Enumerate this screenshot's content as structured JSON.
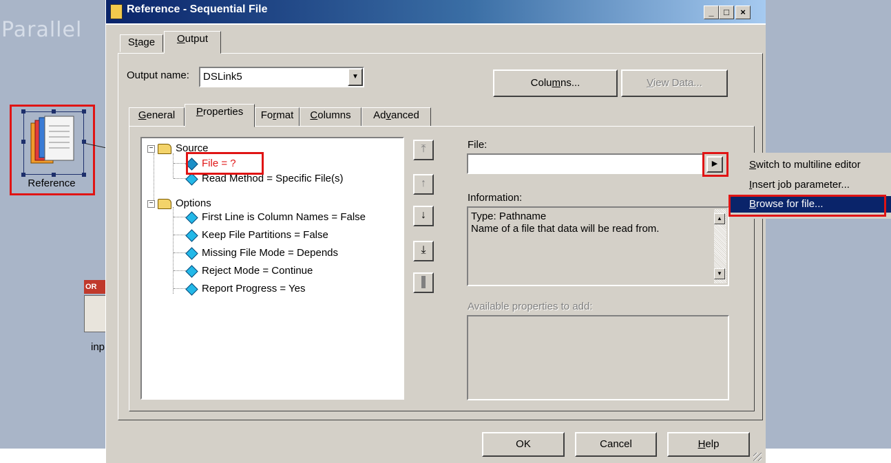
{
  "background": {
    "title": "Parallel",
    "stage_labels": {
      "reference": "Reference",
      "input": "inp",
      "input_badge": "OR"
    }
  },
  "dialog": {
    "title": "Reference - Sequential File",
    "window_buttons": {
      "minimize": "_",
      "maximize": "□",
      "close": "×"
    },
    "top_tabs": [
      {
        "label": "Stage",
        "mnemonic": "t"
      },
      {
        "label": "Output",
        "mnemonic": "O"
      }
    ],
    "output_name": {
      "label": "Output name:",
      "value": "DSLink5"
    },
    "columns_button": "Columns...",
    "view_data_button": "View Data...",
    "inner_tabs": [
      "General",
      "Properties",
      "Format",
      "Columns",
      "Advanced"
    ],
    "tree": {
      "source": "Source",
      "file": "File = ?",
      "read_method": "Read Method = Specific File(s)",
      "options": "Options",
      "option_items": [
        "First Line is Column Names = False",
        "Keep File Partitions = False",
        "Missing File Mode = Depends",
        "Reject Mode = Continue",
        "Report Progress = Yes"
      ]
    },
    "file_label": "File:",
    "file_value": "",
    "information_label": "Information:",
    "information_text": [
      "Type: Pathname",
      "Name of a file that data will be read from."
    ],
    "available_label": "Available properties to add:",
    "ok_button": "OK",
    "cancel_button": "Cancel",
    "help_button": "Help"
  },
  "context_menu": {
    "items": [
      "Switch to multiline editor",
      "Insert job parameter...",
      "Browse for file..."
    ],
    "selected_index": 2
  },
  "highlight_color": "#e01414",
  "selection_color": "#0a246a"
}
